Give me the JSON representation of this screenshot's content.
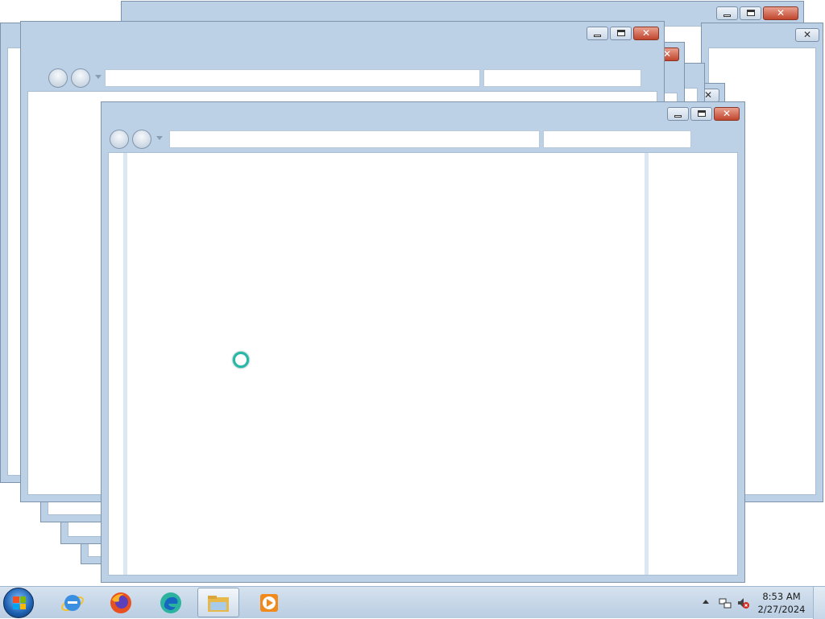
{
  "desktop": {
    "background": "#ffffff",
    "window_count": 9,
    "window_frame_color": "#bcd0e6",
    "close_button_color": "#c0452c"
  },
  "window_controls": {
    "minimize_icon": "minimize-icon",
    "maximize_icon": "maximize-icon",
    "close_icon": "close-icon"
  },
  "browser_toolbar": {
    "back_icon": "back-arrow-icon",
    "forward_icon": "forward-arrow-icon",
    "address_value": "",
    "search_value": ""
  },
  "cursor": {
    "icon": "busy-spinner-icon",
    "color": "#28b8a8"
  },
  "taskbar": {
    "start_icon": "windows-start-icon",
    "pinned": [
      {
        "name": "Internet Explorer",
        "icon": "internet-explorer-icon"
      },
      {
        "name": "Firefox",
        "icon": "firefox-icon"
      },
      {
        "name": "Edge",
        "icon": "edge-icon"
      },
      {
        "name": "File Explorer",
        "icon": "file-explorer-icon",
        "active": true
      },
      {
        "name": "Media Player",
        "icon": "media-player-icon"
      }
    ],
    "tray": {
      "show_hidden_icon": "chevron-up-icon",
      "network_icon": "network-icon",
      "volume_icon": "volume-muted-icon",
      "time": "8:53 AM",
      "date": "2/27/2024"
    }
  }
}
